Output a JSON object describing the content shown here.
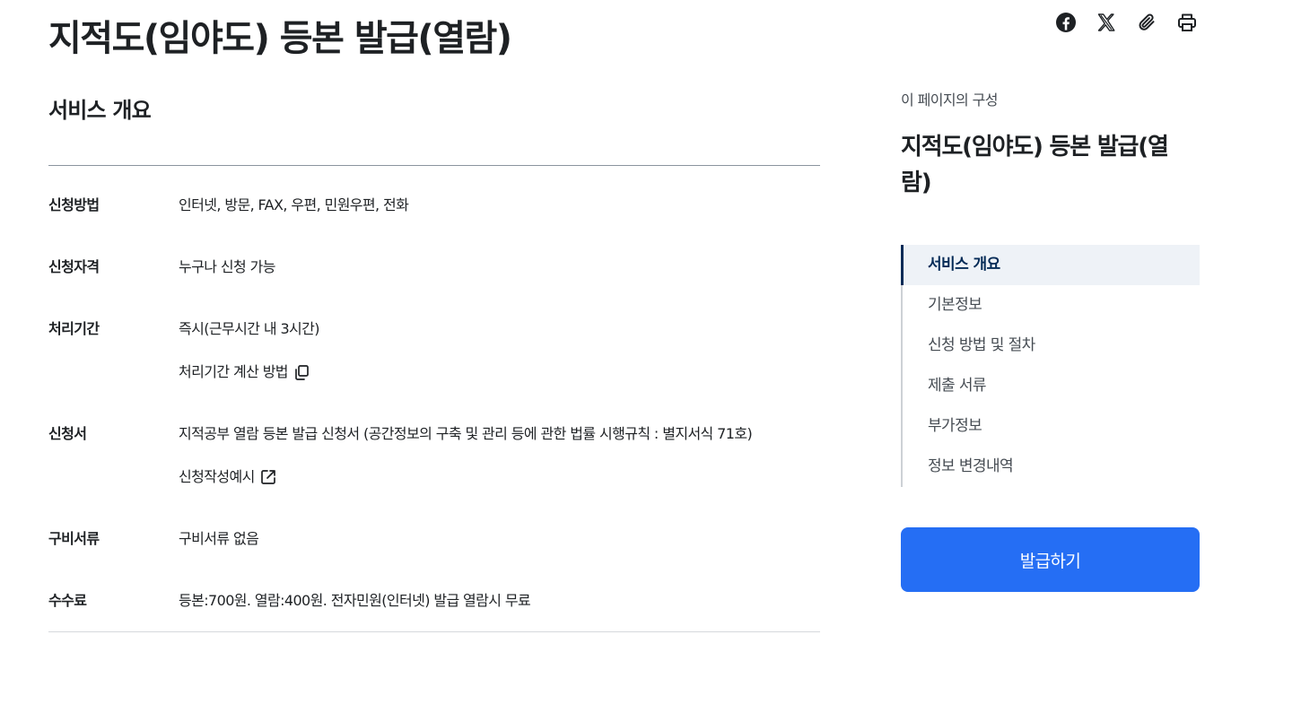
{
  "page": {
    "title": "지적도(임야도) 등본 발급(열람)"
  },
  "share": {
    "icons": [
      "facebook-icon",
      "x-icon",
      "attachment-clip-icon",
      "printer-icon"
    ]
  },
  "overview": {
    "section_title": "서비스 개요",
    "rows": [
      {
        "label": "신청방법",
        "value": "인터넷, 방문, FAX, 우편, 민원우편, 전화"
      },
      {
        "label": "신청자격",
        "value": "누구나 신청 가능"
      },
      {
        "label": "처리기간",
        "value": "즉시(근무시간 내 3시간)",
        "link": "처리기간 계산 방법",
        "link_icon": "copy-icon"
      },
      {
        "label": "신청서",
        "value": "지적공부 열람 등본 발급 신청서 (공간정보의 구축 및 관리 등에 관한 법률 시행규칙 : 별지서식 71호)",
        "link": "신청작성예시",
        "link_icon": "external-link-icon"
      },
      {
        "label": "구비서류",
        "value": "구비서류 없음"
      },
      {
        "label": "수수료",
        "value": "등본:700원. 열람:400원. 전자민원(인터넷) 발급 열람시 무료"
      }
    ]
  },
  "toc": {
    "caption": "이 페이지의 구성",
    "heading": "지적도(임야도) 등본 발급(열람)",
    "items": [
      {
        "label": "서비스 개요",
        "active": true
      },
      {
        "label": "기본정보",
        "active": false
      },
      {
        "label": "신청 방법 및 절차",
        "active": false
      },
      {
        "label": "제출 서류",
        "active": false
      },
      {
        "label": "부가정보",
        "active": false
      },
      {
        "label": "정보 변경내역",
        "active": false
      }
    ]
  },
  "actions": {
    "issue_label": "발급하기"
  },
  "colors": {
    "primary_button": "#256ef4",
    "toc_active_bg": "#eef2f7",
    "toc_active_text": "#052b57",
    "text": "#1e2124"
  }
}
